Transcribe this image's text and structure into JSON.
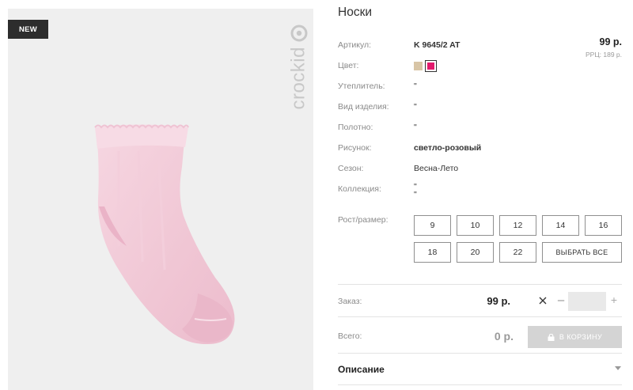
{
  "badge": {
    "label": "NEW"
  },
  "brand": {
    "logo_text": "crockid"
  },
  "product": {
    "title": "Носки",
    "price": "99 р.",
    "rrp": "РРЦ: 189 р.",
    "attributes": [
      {
        "label": "Артикул:",
        "value": "K 9645/2 AT"
      },
      {
        "label": "Цвет:",
        "value": ""
      },
      {
        "label": "Утеплитель:",
        "value": "\""
      },
      {
        "label": "Вид изделия:",
        "value": "\""
      },
      {
        "label": "Полотно:",
        "value": "\""
      },
      {
        "label": "Рисунок:",
        "value": "светло-розовый"
      },
      {
        "label": "Сезон:",
        "value": "Весна-Лето"
      },
      {
        "label": "Коллекция:",
        "value": "\"",
        "value2": "\""
      }
    ],
    "colors": [
      {
        "name": "beige",
        "hex": "#d8c5a6",
        "selected": false
      },
      {
        "name": "pink",
        "hex": "#e2196c",
        "selected": true
      }
    ]
  },
  "sizes": {
    "label": "Рост/размер:",
    "options": [
      "9",
      "10",
      "12",
      "14",
      "16",
      "18",
      "20",
      "22"
    ],
    "select_all": "ВЫБРАТЬ ВСЕ"
  },
  "order": {
    "label": "Заказ:",
    "price": "99 р.",
    "quantity": "",
    "minus": "–",
    "plus": "+"
  },
  "total": {
    "label": "Всего:",
    "amount": "0 р.",
    "cart_button": "В КОРЗИНУ"
  },
  "description": {
    "title": "Описание"
  }
}
